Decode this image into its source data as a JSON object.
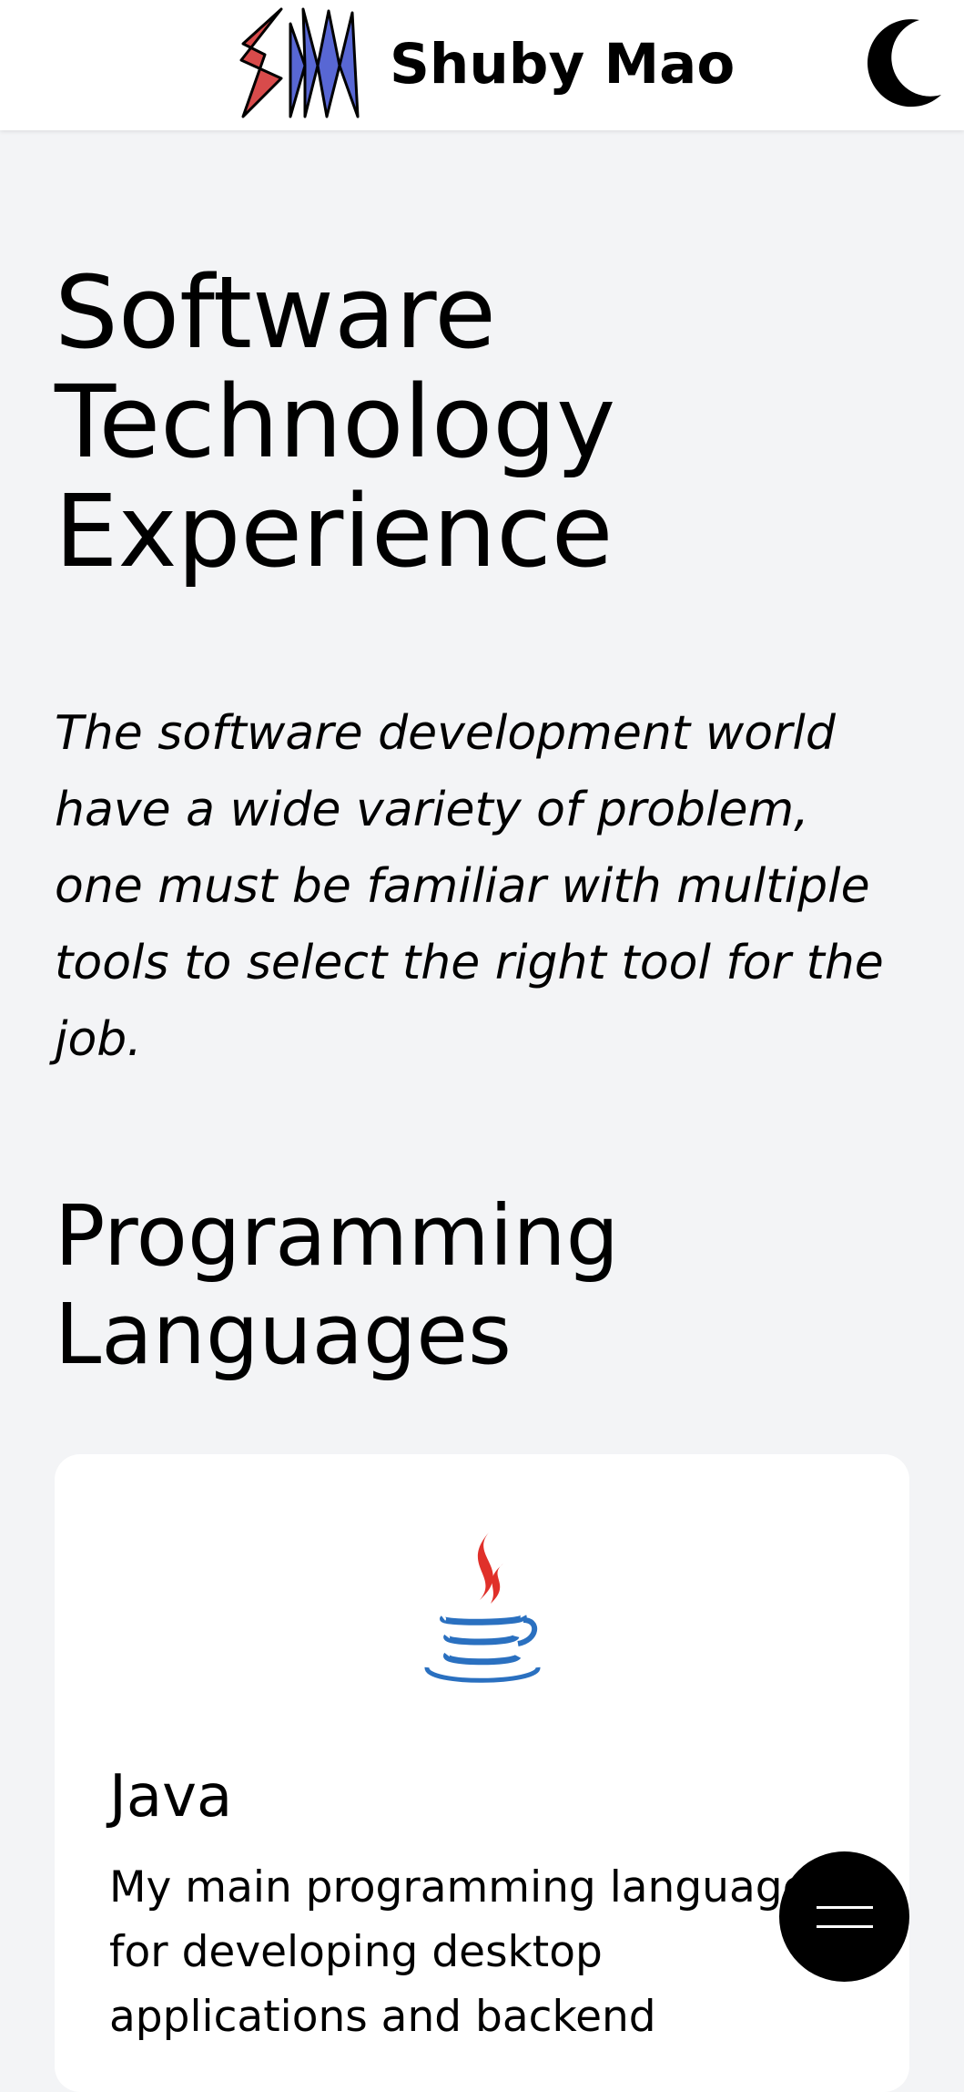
{
  "header": {
    "site_name": "Shuby Mao",
    "logo_icon": "sm-logo",
    "theme_toggle_icon": "moon-icon"
  },
  "main": {
    "title": "Software Technology Experience",
    "intro": "The software development world have a wide variety of problem, one must be familiar with multiple tools to select the right tool for the job.",
    "section_title": "Programming Languages",
    "cards": [
      {
        "icon": "java-icon",
        "title": "Java",
        "description": "My main programming language for developing desktop applications and backend"
      }
    ]
  },
  "fab": {
    "icon": "menu-icon"
  },
  "colors": {
    "background": "#f3f4f6",
    "header": "#ffffff",
    "logo_red": "#d84b4b",
    "logo_blue": "#5867d4",
    "java_red": "#e0302a",
    "java_blue": "#2a70c0"
  }
}
